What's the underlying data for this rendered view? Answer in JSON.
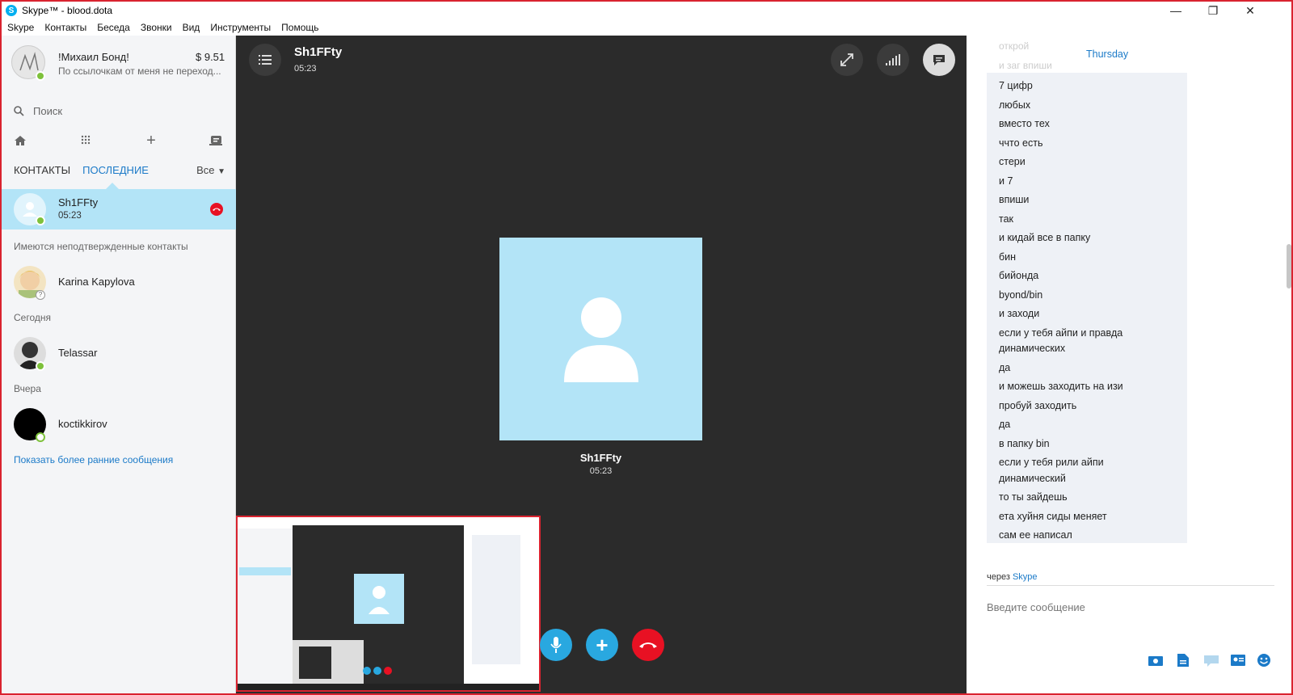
{
  "window": {
    "title": "Skype™ - blood.dota",
    "logo_letter": "S"
  },
  "menu": [
    "Skype",
    "Контакты",
    "Беседа",
    "Звонки",
    "Вид",
    "Инструменты",
    "Помощь"
  ],
  "profile": {
    "name": "!Михаил Бонд!",
    "balance": "$ 9.51",
    "mood": "По ссылочкам от меня не переход..."
  },
  "search": {
    "placeholder": "Поиск"
  },
  "tabs": {
    "contacts": "КОНТАКТЫ",
    "recent": "ПОСЛЕДНИЕ",
    "filter": "Все"
  },
  "active_call_contact": {
    "name": "Sh1FFty",
    "duration": "05:23"
  },
  "sections": {
    "unconfirmed": "Имеются неподтвержденные контакты",
    "today": "Сегодня",
    "yesterday": "Вчера"
  },
  "contacts": [
    {
      "name": "Karina Kapylova",
      "status": "unknown"
    },
    {
      "name": "Telassar",
      "status": "online"
    },
    {
      "name": "koctikkirov",
      "status": "offline"
    }
  ],
  "show_earlier": "Показать более ранние сообщения",
  "call": {
    "name": "Sh1FFty",
    "duration": "05:23",
    "avatar_color": "#b3e4f7"
  },
  "chat": {
    "faded_top": [
      "открой",
      "и заг впиши"
    ],
    "day_label": "Thursday",
    "messages": [
      "7 цифр",
      "любых",
      "вместо тех",
      "ччто есть",
      "стери",
      "и 7",
      "впиши",
      "так",
      "и кидай все в папку",
      "бин",
      "бийонда",
      "byond/bin",
      "и заходи",
      "если у тебя айпи и правда",
      "динамических",
      "да",
      "и можешь заходить на изи",
      "пробуй заходить",
      "да",
      "в папку bin",
      "если у тебя рили айпи",
      "динамический",
      "то ты зайдешь",
      "ета хуйня сиды меняет",
      "сам ее написал"
    ],
    "via_prefix": "через",
    "via_link": "Skype",
    "input_placeholder": "Введите сообщение"
  },
  "colors": {
    "accent": "#00aff0",
    "hangup": "#e81123",
    "online": "#7ec13b",
    "link": "#1b7ac8",
    "call_bg": "#2b2b2b"
  }
}
